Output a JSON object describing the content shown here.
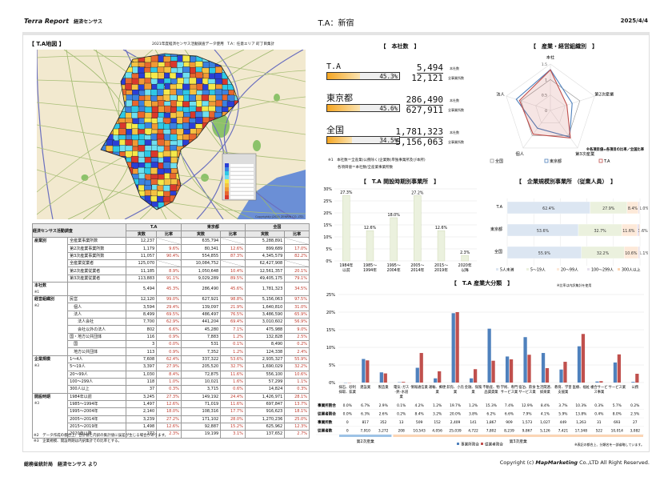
{
  "header": {
    "brand": "Terra Report",
    "brand_sub": "経済センサス",
    "title": "T.A：新宿",
    "date": "2025/4/4"
  },
  "map": {
    "title": "【 T.A地図 】",
    "subtitle": "2021年度経済センサス活動調査データ使用　T.A：任意エリア 町丁目集計",
    "copyright": "Copyright(c)2025 ZENRIN CO.,LTD.",
    "palette": [
      "#2a3fd6",
      "#3b82e0",
      "#2ec8e6",
      "#6fe0f0",
      "#f5e94a",
      "#f5c242",
      "#f09a35",
      "#e8672e",
      "#d9382c"
    ]
  },
  "table": {
    "title": "経済センサス活動調査",
    "groups": [
      "T.A",
      "東京都",
      "全国"
    ],
    "subheads": [
      "実数",
      "比率"
    ],
    "sections": [
      {
        "label": "産業別",
        "note": "",
        "rows": [
          [
            "全産業事業所数",
            "12,237",
            "",
            "635,794",
            "",
            "5,288,891",
            ""
          ],
          [
            "第2次産業事業所数",
            "1,179",
            "9.6%",
            "80,341",
            "12.6%",
            "899,689",
            "17.0%"
          ],
          [
            "第3次産業事業所数",
            "11,057",
            "90.4%",
            "554,855",
            "87.3%",
            "4,345,579",
            "82.2%"
          ],
          [
            "全産業従業者",
            "125,070",
            "",
            "10,084,752",
            "",
            "62,427,908",
            ""
          ],
          [
            "第2次産業従業者",
            "11,185",
            "8.9%",
            "1,050,648",
            "10.4%",
            "12,561,357",
            "20.1%"
          ],
          [
            "第3次産業従業者",
            "113,883",
            "91.1%",
            "9,029,289",
            "89.5%",
            "49,405,175",
            "79.1%"
          ]
        ]
      },
      {
        "label": "本社数",
        "note": "※1",
        "rows": [
          [
            "",
            "5,494",
            "45.3%",
            "286,490",
            "45.6%",
            "1,781,323",
            "34.5%"
          ]
        ]
      },
      {
        "label": "経営組織別",
        "note": "※2",
        "rows": [
          [
            "民営",
            "12,120",
            "99.0%",
            "627,921",
            "98.8%",
            "5,156,063",
            "97.5%"
          ],
          [
            "　個人",
            "3,594",
            "29.4%",
            "139,097",
            "21.9%",
            "1,640,810",
            "31.0%"
          ],
          [
            "　法人",
            "8,499",
            "69.5%",
            "486,497",
            "76.5%",
            "3,486,590",
            "65.9%"
          ],
          [
            "　　法人会社",
            "7,700",
            "62.9%",
            "441,204",
            "69.4%",
            "3,010,602",
            "56.9%"
          ],
          [
            "　　会社以外の法人",
            "802",
            "6.6%",
            "45,280",
            "7.1%",
            "475,988",
            "9.0%"
          ],
          [
            "国・地方公共団体",
            "116",
            "0.9%",
            "7,883",
            "1.2%",
            "132,828",
            "2.5%"
          ],
          [
            "　国",
            "3",
            "0.0%",
            "531",
            "0.1%",
            "8,490",
            "0.2%"
          ],
          [
            "　地方公共団体",
            "113",
            "0.9%",
            "7,352",
            "1.2%",
            "124,338",
            "2.4%"
          ]
        ]
      },
      {
        "label": "企業規模",
        "note": "※3",
        "rows": [
          [
            "1～4人",
            "7,608",
            "62.4%",
            "337,322",
            "53.6%",
            "2,935,327",
            "55.9%"
          ],
          [
            "5～19人",
            "3,397",
            "27.9%",
            "205,520",
            "32.7%",
            "1,690,029",
            "32.2%"
          ],
          [
            "20～99人",
            "1,030",
            "8.4%",
            "72,875",
            "11.6%",
            "556,100",
            "10.6%"
          ],
          [
            "100～299人",
            "118",
            "1.0%",
            "10,021",
            "1.6%",
            "57,299",
            "1.1%"
          ],
          [
            "300人以上",
            "37",
            "0.3%",
            "3,715",
            "0.6%",
            "14,824",
            "0.3%"
          ]
        ]
      },
      {
        "label": "開設時期",
        "note": "※3",
        "rows": [
          [
            "1984年以前",
            "3,245",
            "27.3%",
            "149,192",
            "24.4%",
            "1,426,971",
            "28.1%"
          ],
          [
            "1985～1994年",
            "1,497",
            "12.6%",
            "71,019",
            "11.6%",
            "697,847",
            "13.7%"
          ],
          [
            "1995～2004年",
            "2,140",
            "18.0%",
            "108,316",
            "17.7%",
            "916,623",
            "18.1%"
          ],
          [
            "2005～2014年",
            "3,239",
            "27.2%",
            "171,102",
            "28.0%",
            "1,270,236",
            "25.0%"
          ],
          [
            "2015～2019年",
            "1,498",
            "12.6%",
            "92,887",
            "15.2%",
            "625,962",
            "12.3%"
          ],
          [
            "2020年以降",
            "272",
            "2.3%",
            "19,199",
            "3.1%",
            "137,652",
            "2.7%"
          ]
        ]
      }
    ],
    "notes": [
      "※2　データ作成の都合上、合計値と内訳の集計値に誤差が生じる場合があります。",
      "※3　企業規模、開設時期は内訳集計での比率とする。"
    ]
  },
  "hq": {
    "title": "【　本社数　】",
    "hq_label": "本社数",
    "all_label": "全事業所数",
    "rows": [
      {
        "name": "T.A",
        "hq": "5,494",
        "all": "12,121",
        "ratio": "45.3%",
        "pct": 45.3
      },
      {
        "name": "東京都",
        "hq": "286,490",
        "all": "627,911",
        "ratio": "45.6%",
        "pct": 45.6
      },
      {
        "name": "全国",
        "hq": "1,781,323",
        "all": "5,156,063",
        "ratio": "34.5%",
        "pct": 34.5
      }
    ],
    "notes": [
      "※1　本社数＝全産業(公務除く)企業数(単独事業所及び本所)",
      "各項目値＝本社数/全産業事業所数"
    ]
  },
  "chart_data": [
    {
      "type": "radar",
      "title": "【　産業・経営組織別　】",
      "axes": [
        "本社",
        "第2次産業",
        "第3次産業",
        "個人",
        "法人"
      ],
      "ticks": [
        "0",
        "0.5",
        "1",
        "1.5"
      ],
      "range": [
        0,
        1.5
      ],
      "series": [
        {
          "name": "全国",
          "values": [
            1,
            1,
            1,
            1,
            1
          ],
          "color": "#999999"
        },
        {
          "name": "東京都",
          "values": [
            1.32,
            0.74,
            1.06,
            0.71,
            1.16
          ],
          "color": "#4f81bd"
        },
        {
          "name": "T.A",
          "values": [
            1.31,
            0.56,
            1.1,
            0.95,
            1.05
          ],
          "color": "#c0504d"
        }
      ],
      "note": "※各項目値=各項目の比率／全国比率"
    },
    {
      "type": "bar",
      "title": "【　T.A 開設時期別事業所　】",
      "categories": [
        [
          "1984年",
          "以前"
        ],
        [
          "1985～",
          "1994年"
        ],
        [
          "1995～",
          "2004年"
        ],
        [
          "2005～",
          "2014年"
        ],
        [
          "2015～",
          "2019年"
        ],
        [
          "2020年",
          "以降"
        ]
      ],
      "values": [
        27.3,
        12.6,
        18.0,
        27.2,
        12.6,
        2.3
      ],
      "labels": [
        "27.3%",
        "12.6%",
        "18.0%",
        "27.2%",
        "12.6%",
        "2.3%"
      ],
      "ylim": [
        0,
        30
      ],
      "yticks": [
        "0%",
        "5%",
        "10%",
        "15%",
        "20%",
        "25%",
        "30%"
      ],
      "grid": true
    },
    {
      "type": "stacked-bar",
      "title": "【　企業規模別事業所 （従業人員）　】",
      "categories": [
        "T.A",
        "東京都",
        "全国"
      ],
      "legend": [
        "5人未満",
        "5～19人",
        "20～99人",
        "100～299人",
        "300人以上"
      ],
      "colors": [
        "#dce6f2",
        "#ebf1de",
        "#fde9d9",
        "#e6e0ec",
        "#fcd5b4"
      ],
      "values": [
        [
          62.4,
          27.9,
          8.4,
          1.0,
          0.3
        ],
        [
          53.6,
          32.7,
          11.6,
          1.6,
          0.6
        ],
        [
          55.9,
          32.2,
          10.6,
          1.1,
          0.3
        ]
      ],
      "labels": [
        [
          "62.4%",
          "27.9%",
          "8.4%",
          "1.0%",
          ""
        ],
        [
          "53.6%",
          "32.7%",
          "11.6%",
          "1.6%",
          ""
        ],
        [
          "55.9%",
          "32.2%",
          "10.6%",
          "1.1%",
          ""
        ]
      ]
    },
    {
      "type": "bar",
      "title": "【　T.A 産業大分類　】",
      "note_top": "※比率は内訳集計を使用",
      "ylim": [
        0,
        25
      ],
      "yticks": [
        "0%",
        "5%",
        "10%",
        "15%",
        "20%",
        "25%"
      ],
      "categories": [
        "採石、砂利採取、鉱業",
        "建設業",
        "製造業",
        "電気･ガス･熱･水道業",
        "情報通信業",
        "運輸、郵便業",
        "卸売、小売業",
        "金融、保険業",
        "不動産、物品賃貸業",
        "学術、専門サービス業",
        "宿泊、飲食サービス業",
        "生活関連、娯楽業",
        "教育、学習支援業",
        "医療、福祉",
        "複合サービス事業",
        "サービス業",
        "公務"
      ],
      "series": [
        {
          "name": "事業所割合",
          "color": "#4f81bd",
          "values": [
            0.0,
            6.7,
            2.9,
            0.1,
            4.2,
            1.2,
            19.7,
            1.2,
            15.3,
            7.4,
            12.9,
            8.4,
            3.7,
            10.3,
            0.3,
            5.7,
            0.2
          ]
        },
        {
          "name": "従業者割合",
          "color": "#c0504d",
          "values": [
            0.0,
            6.3,
            2.6,
            0.2,
            8.4,
            3.2,
            20.0,
            3.8,
            6.2,
            6.6,
            7.9,
            4.1,
            5.9,
            13.8,
            0.4,
            8.0,
            2.5
          ]
        }
      ],
      "table_rows": [
        {
          "label": "事業所割合",
          "values": [
            "0.0%",
            "6.7%",
            "2.9%",
            "0.1%",
            "4.2%",
            "1.2%",
            "19.7%",
            "1.2%",
            "15.3%",
            "7.4%",
            "12.9%",
            "8.4%",
            "3.7%",
            "10.3%",
            "0.3%",
            "5.7%",
            "0.2%"
          ]
        },
        {
          "label": "従業者割合",
          "values": [
            "0.0%",
            "6.3%",
            "2.6%",
            "0.2%",
            "8.4%",
            "3.2%",
            "20.0%",
            "3.8%",
            "6.2%",
            "6.6%",
            "7.9%",
            "4.1%",
            "5.9%",
            "13.8%",
            "0.4%",
            "8.0%",
            "2.5%"
          ]
        },
        {
          "label": "事業所数",
          "values": [
            "0",
            "817",
            "352",
            "13",
            "509",
            "152",
            "2,409",
            "141",
            "1,867",
            "909",
            "1,573",
            "1,027",
            "449",
            "1,263",
            "31",
            "693",
            "27"
          ]
        },
        {
          "label": "従業者数",
          "values": [
            "0",
            "7,910",
            "3,272",
            "208",
            "10,543",
            "4,056",
            "25,039",
            "4,722",
            "7,802",
            "8,239",
            "9,867",
            "5,126",
            "7,421",
            "17,348",
            "522",
            "10,014",
            "3,082"
          ]
        }
      ],
      "groups": [
        {
          "label": "第2次産業",
          "count": 3,
          "color": "#9dc3e6"
        },
        {
          "label": "第3次産業",
          "count": 14,
          "color": "#fbd5b5"
        }
      ],
      "note_bottom": "※表記の都合上、分類名を一部省略しています。"
    }
  ],
  "footer": {
    "source": "総務省統計局　経済センサス より",
    "copyright_pre": "Copyright (c) ",
    "copyright_brand": "MapMarketing",
    "copyright_post": " Co.,LTD All Right Reserved."
  }
}
